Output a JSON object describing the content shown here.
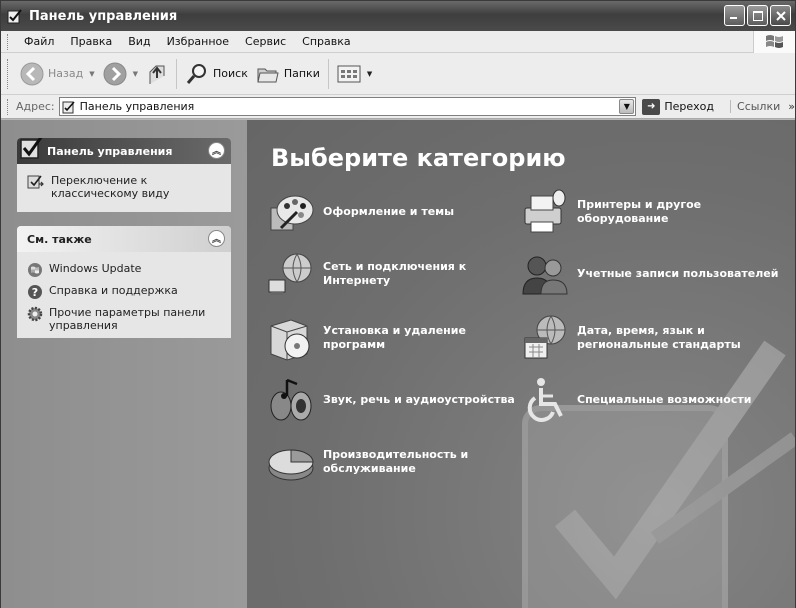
{
  "window": {
    "title": "Панель управления"
  },
  "menu": {
    "items": [
      {
        "label": "Файл"
      },
      {
        "label": "Правка"
      },
      {
        "label": "Вид"
      },
      {
        "label": "Избранное"
      },
      {
        "label": "Сервис"
      },
      {
        "label": "Справка"
      }
    ]
  },
  "toolbar": {
    "back_label": "Назад",
    "search_label": "Поиск",
    "folders_label": "Папки"
  },
  "address": {
    "label": "Адрес:",
    "value": "Панель управления",
    "go_label": "Переход",
    "links_label": "Ссылки"
  },
  "sidebar": {
    "panel1": {
      "title": "Панель управления",
      "task": "Переключение к классическому виду"
    },
    "panel2": {
      "title": "См. также",
      "items": [
        {
          "label": "Windows Update"
        },
        {
          "label": "Справка и поддержка"
        },
        {
          "label": "Прочие параметры панели управления"
        }
      ]
    }
  },
  "main": {
    "title": "Выберите категорию",
    "categories": [
      {
        "label": "Оформление и темы"
      },
      {
        "label": "Сеть и подключения к Интернету"
      },
      {
        "label": "Установка и удаление программ"
      },
      {
        "label": "Звук, речь и аудиоустройства"
      },
      {
        "label": "Производительность и обслуживание"
      },
      {
        "label": "Принтеры и другое оборудование"
      },
      {
        "label": "Учетные записи пользователей"
      },
      {
        "label": "Дата, время, язык и региональные стандарты"
      },
      {
        "label": "Специальные возможности"
      }
    ]
  }
}
